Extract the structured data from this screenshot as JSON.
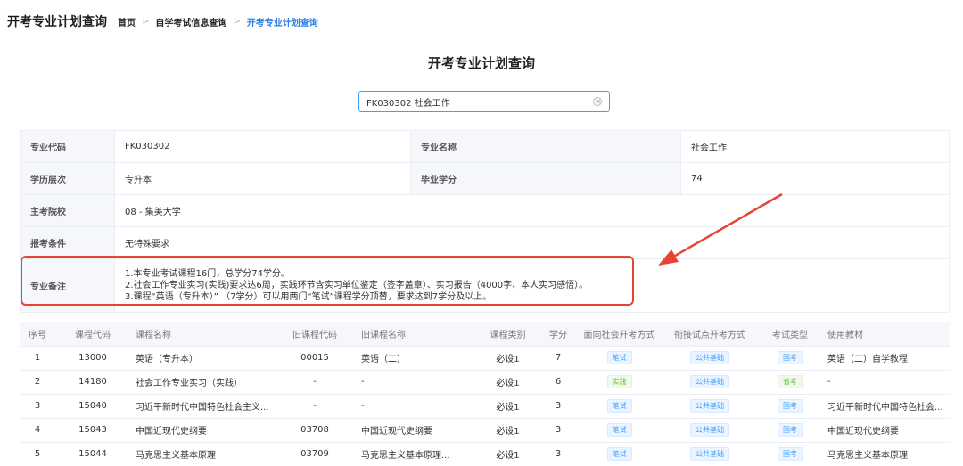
{
  "header": {
    "title": "开考专业计划查询",
    "breadcrumb": [
      "首页",
      "自学考试信息查询",
      "开考专业计划查询"
    ]
  },
  "page_title": "开考专业计划查询",
  "search": {
    "value": "FK030302 社会工作"
  },
  "info": {
    "major_code_label": "专业代码",
    "major_code": "FK030302",
    "major_name_label": "专业名称",
    "major_name": "社会工作",
    "level_label": "学历层次",
    "level": "专升本",
    "credits_label": "毕业学分",
    "credits": "74",
    "school_label": "主考院校",
    "school": "08 - 集美大学",
    "condition_label": "报考条件",
    "condition": "无特殊要求",
    "notes_label": "专业备注",
    "notes": [
      "1.本专业考试课程16门，总学分74学分。",
      "2.社会工作专业实习(实践)要求达6周，实践环节含实习单位鉴定（签字盖章）、实习报告（4000字、本人实习感悟）。",
      "3.课程“英语（专升本）” （7学分）可以用两门“笔试”课程学分顶替，要求达到7学分及以上。"
    ]
  },
  "table": {
    "headers": [
      "序号",
      "课程代码",
      "课程名称",
      "旧课程代码",
      "旧课程名称",
      "课程类别",
      "学分",
      "面向社会开考方式",
      "衔接试点开考方式",
      "考试类型",
      "使用教材"
    ],
    "rows": [
      [
        "1",
        "13000",
        "英语（专升本）",
        "00015",
        "英语（二）",
        "必设1",
        "7",
        "笔试",
        "公共基础",
        "国考",
        "英语（二）自学教程"
      ],
      [
        "2",
        "14180",
        "社会工作专业实习（实践）",
        "-",
        "-",
        "必设1",
        "6",
        "实践",
        "公共基础",
        "省考",
        "-"
      ],
      [
        "3",
        "15040",
        "习近平新时代中国特色社会主义...",
        "-",
        "-",
        "必设1",
        "3",
        "笔试",
        "公共基础",
        "国考",
        "习近平新时代中国特色社会..."
      ],
      [
        "4",
        "15043",
        "中国近现代史纲要",
        "03708",
        "中国近现代史纲要",
        "必设1",
        "3",
        "笔试",
        "公共基础",
        "国考",
        "中国近现代史纲要"
      ],
      [
        "5",
        "15044",
        "马克思主义基本原理",
        "03709",
        "马克思主义基本原理...",
        "必设1",
        "3",
        "笔试",
        "公共基础",
        "国考",
        "马克思主义基本原理"
      ]
    ],
    "tag_colors": {
      "笔试": "blue",
      "实践": "green",
      "公共基础": "blue",
      "国考": "blue",
      "省考": "green"
    }
  },
  "colors": {
    "accent": "#409eff",
    "highlight": "#e64533",
    "green": "#67c23a"
  }
}
